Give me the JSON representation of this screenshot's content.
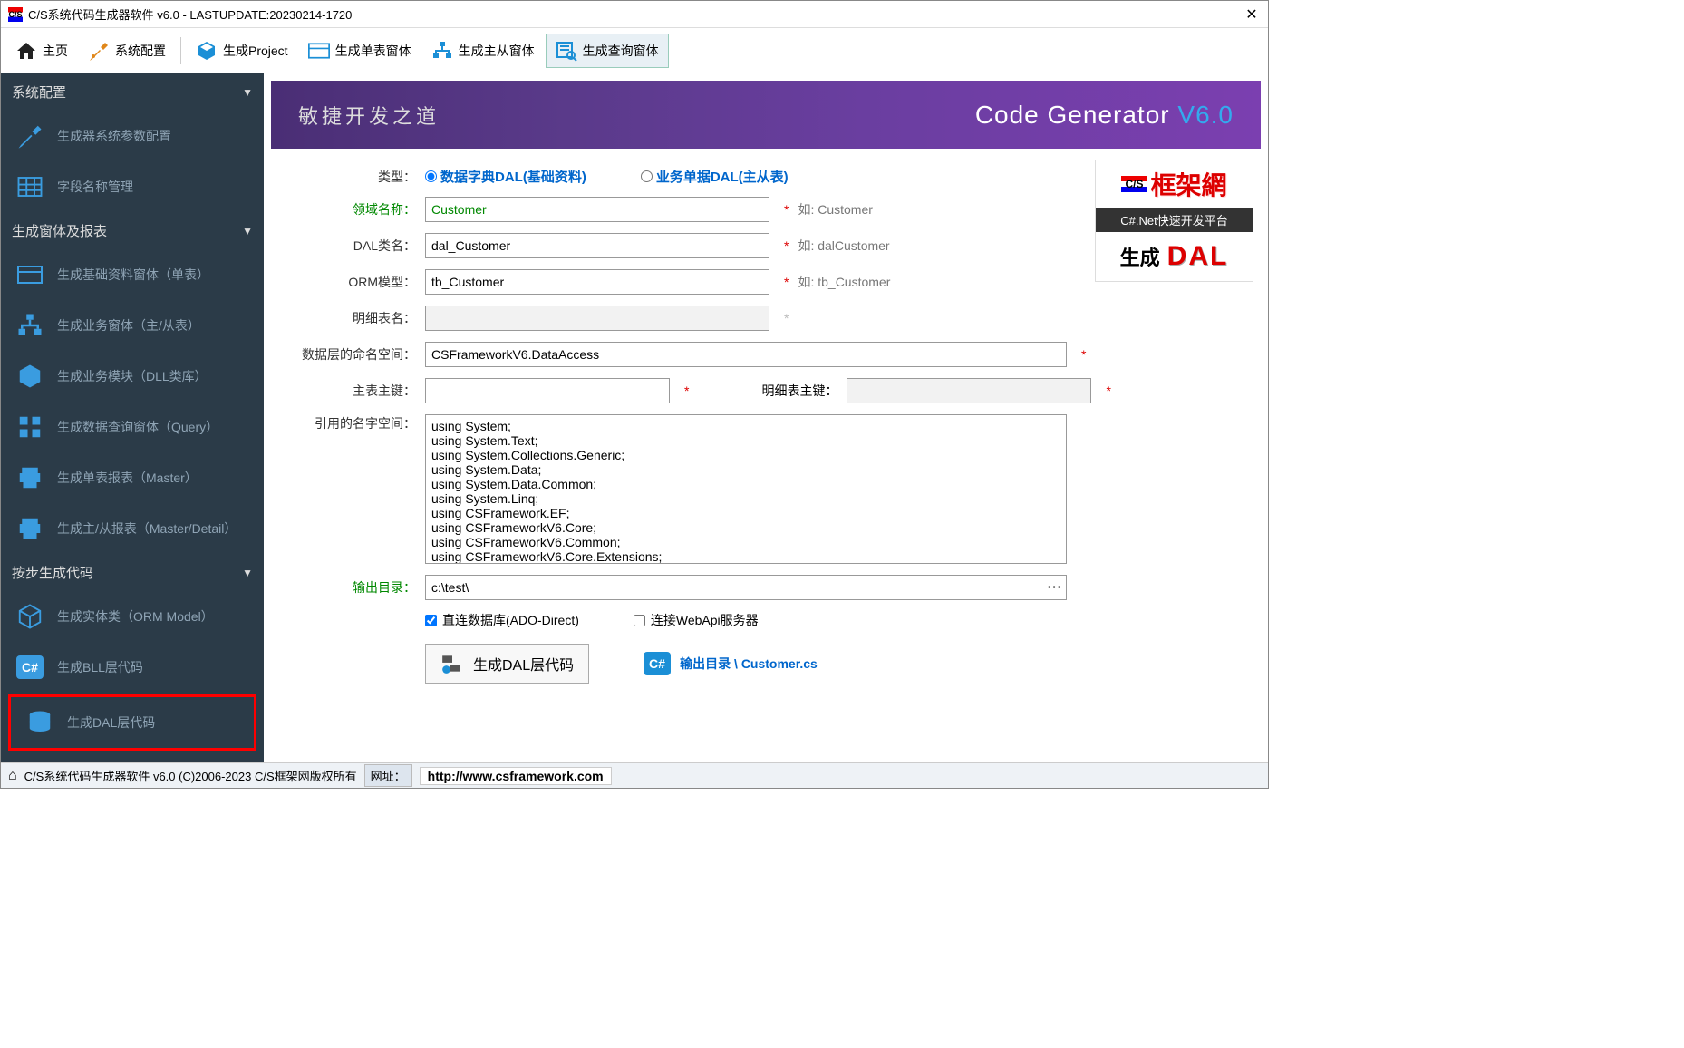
{
  "window": {
    "title": "C/S系统代码生成器软件 v6.0 - LASTUPDATE:20230214-1720"
  },
  "toolbar": {
    "home": "主页",
    "config": "系统配置",
    "gen_project": "生成Project",
    "gen_single": "生成单表窗体",
    "gen_master": "生成主从窗体",
    "gen_query": "生成查询窗体"
  },
  "sidebar": {
    "group_config": "系统配置",
    "item_sys_params": "生成器系统参数配置",
    "item_field_names": "字段名称管理",
    "group_forms": "生成窗体及报表",
    "item_basic_form": "生成基础资料窗体（单表）",
    "item_biz_form": "生成业务窗体（主/从表）",
    "item_biz_module": "生成业务模块（DLL类库）",
    "item_query_form": "生成数据查询窗体（Query）",
    "item_single_report": "生成单表报表（Master）",
    "item_master_report": "生成主/从报表（Master/Detail）",
    "group_step": "按步生成代码",
    "item_orm": "生成实体类（ORM Model）",
    "item_bll": "生成BLL层代码",
    "item_dal": "生成DAL层代码"
  },
  "banner": {
    "left": "敏捷开发之道",
    "right_a": "Code Generator ",
    "right_b": "V6.0"
  },
  "badge": {
    "title": "框架網",
    "subtitle": "C#.Net快速开发平台",
    "gen": "生成",
    "dal": "DAL"
  },
  "form": {
    "type_label": "类型：",
    "type_opt1": "数据字典DAL(基础资料)",
    "type_opt2": "业务单据DAL(主从表)",
    "domain_label": "领域名称：",
    "domain_value": "Customer",
    "domain_hint": "如: Customer",
    "dal_name_label": "DAL类名：",
    "dal_name_value": "dal_Customer",
    "dal_name_hint": "如: dalCustomer",
    "orm_label": "ORM模型：",
    "orm_value": "tb_Customer",
    "orm_hint": "如: tb_Customer",
    "detail_table_label": "明细表名：",
    "detail_table_value": "",
    "ns_label": "数据层的命名空间：",
    "ns_value": "CSFrameworkV6.DataAccess",
    "pk_label": "主表主键：",
    "pk_value": "",
    "detail_pk_label": "明细表主键：",
    "detail_pk_value": "",
    "ref_ns_label": "引用的名字空间：",
    "ref_ns_value": "using System;\nusing System.Text;\nusing System.Collections.Generic;\nusing System.Data;\nusing System.Data.Common;\nusing System.Linq;\nusing CSFramework.EF;\nusing CSFrameworkV6.Core;\nusing CSFrameworkV6.Common;\nusing CSFrameworkV6.Core.Extensions;",
    "output_dir_label": "输出目录：",
    "output_dir_value": "c:\\test\\",
    "chk_ado": "直连数据库(ADO-Direct)",
    "chk_webapi": "连接WebApi服务器",
    "btn_generate": "生成DAL层代码",
    "output_link_prefix": "输出目录 \\ ",
    "output_link_file": "Customer.cs"
  },
  "statusbar": {
    "text": "C/S系统代码生成器软件 v6.0 (C)2006-2023 C/S框架网版权所有",
    "url_label": "网址：",
    "url": "http://www.csframework.com"
  }
}
